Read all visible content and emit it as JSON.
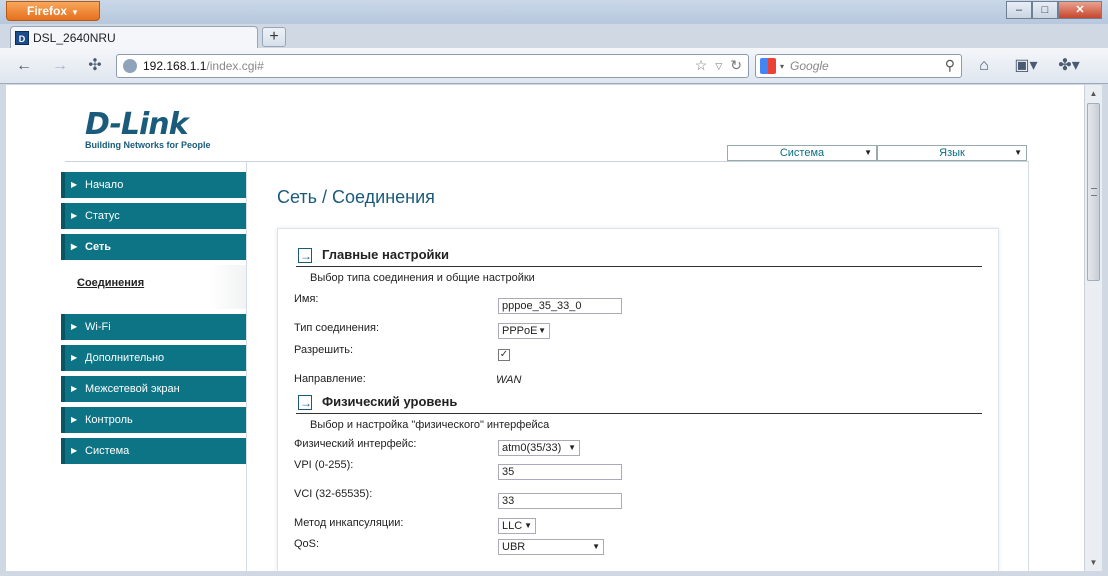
{
  "browser": {
    "menu_button": "Firefox",
    "tab_title": "DSL_2640NRU",
    "tab_icon_letter": "D",
    "new_tab": "+",
    "url_host": "192.168.1.1",
    "url_path": "/index.cgi#",
    "search_placeholder": "Google",
    "window_controls": {
      "minimize": "–",
      "maximize": "□",
      "close": "✕"
    }
  },
  "header": {
    "logo_text": "D-Link",
    "logo_tagline": "Building Networks for People",
    "system_dropdown": "Система",
    "language_dropdown": "Язык"
  },
  "sidebar": {
    "items": [
      {
        "label": "Начало"
      },
      {
        "label": "Статус"
      },
      {
        "label": "Сеть"
      },
      {
        "label": "Соединения"
      },
      {
        "label": "Wi-Fi"
      },
      {
        "label": "Дополнительно"
      },
      {
        "label": "Межсетевой экран"
      },
      {
        "label": "Контроль"
      },
      {
        "label": "Система"
      }
    ]
  },
  "main": {
    "title": "Сеть / Соединения",
    "general": {
      "heading": "Главные настройки",
      "description": "Выбор типа соединения и общие настройки",
      "name_label": "Имя:",
      "name_value": "pppoe_35_33_0",
      "conn_type_label": "Тип соединения:",
      "conn_type_value": "PPPoE",
      "enable_label": "Разрешить:",
      "enable_checked": true,
      "direction_label": "Направление:",
      "direction_value": "WAN"
    },
    "physical": {
      "heading": "Физический уровень",
      "description": "Выбор и настройка \"физического\" интерфейса",
      "iface_label": "Физический интерфейс:",
      "iface_value": "atm0(35/33)",
      "vpi_label": "VPI (0-255):",
      "vpi_value": "35",
      "vci_label": "VCI (32-65535):",
      "vci_value": "33",
      "encap_label": "Метод инкапсуляции:",
      "encap_value": "LLC",
      "qos_label": "QoS:",
      "qos_value": "UBR"
    }
  }
}
